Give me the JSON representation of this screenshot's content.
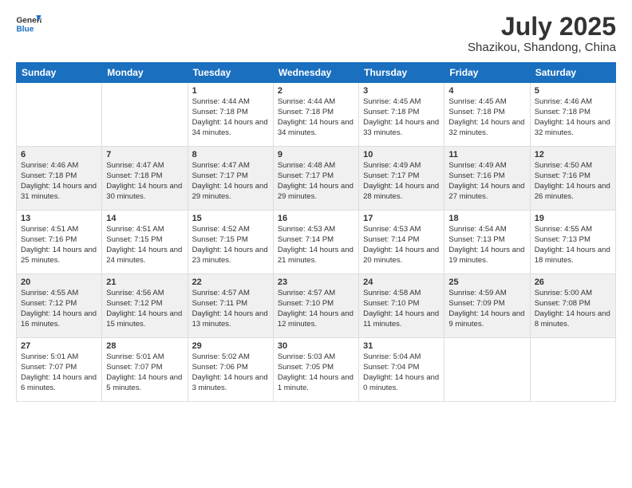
{
  "logo": {
    "line1": "General",
    "line2": "Blue"
  },
  "title": "July 2025",
  "location": "Shazikou, Shandong, China",
  "days_header": [
    "Sunday",
    "Monday",
    "Tuesday",
    "Wednesday",
    "Thursday",
    "Friday",
    "Saturday"
  ],
  "weeks": [
    [
      {
        "day": "",
        "sunrise": "",
        "sunset": "",
        "daylight": ""
      },
      {
        "day": "",
        "sunrise": "",
        "sunset": "",
        "daylight": ""
      },
      {
        "day": "1",
        "sunrise": "Sunrise: 4:44 AM",
        "sunset": "Sunset: 7:18 PM",
        "daylight": "Daylight: 14 hours and 34 minutes."
      },
      {
        "day": "2",
        "sunrise": "Sunrise: 4:44 AM",
        "sunset": "Sunset: 7:18 PM",
        "daylight": "Daylight: 14 hours and 34 minutes."
      },
      {
        "day": "3",
        "sunrise": "Sunrise: 4:45 AM",
        "sunset": "Sunset: 7:18 PM",
        "daylight": "Daylight: 14 hours and 33 minutes."
      },
      {
        "day": "4",
        "sunrise": "Sunrise: 4:45 AM",
        "sunset": "Sunset: 7:18 PM",
        "daylight": "Daylight: 14 hours and 32 minutes."
      },
      {
        "day": "5",
        "sunrise": "Sunrise: 4:46 AM",
        "sunset": "Sunset: 7:18 PM",
        "daylight": "Daylight: 14 hours and 32 minutes."
      }
    ],
    [
      {
        "day": "6",
        "sunrise": "Sunrise: 4:46 AM",
        "sunset": "Sunset: 7:18 PM",
        "daylight": "Daylight: 14 hours and 31 minutes."
      },
      {
        "day": "7",
        "sunrise": "Sunrise: 4:47 AM",
        "sunset": "Sunset: 7:18 PM",
        "daylight": "Daylight: 14 hours and 30 minutes."
      },
      {
        "day": "8",
        "sunrise": "Sunrise: 4:47 AM",
        "sunset": "Sunset: 7:17 PM",
        "daylight": "Daylight: 14 hours and 29 minutes."
      },
      {
        "day": "9",
        "sunrise": "Sunrise: 4:48 AM",
        "sunset": "Sunset: 7:17 PM",
        "daylight": "Daylight: 14 hours and 29 minutes."
      },
      {
        "day": "10",
        "sunrise": "Sunrise: 4:49 AM",
        "sunset": "Sunset: 7:17 PM",
        "daylight": "Daylight: 14 hours and 28 minutes."
      },
      {
        "day": "11",
        "sunrise": "Sunrise: 4:49 AM",
        "sunset": "Sunset: 7:16 PM",
        "daylight": "Daylight: 14 hours and 27 minutes."
      },
      {
        "day": "12",
        "sunrise": "Sunrise: 4:50 AM",
        "sunset": "Sunset: 7:16 PM",
        "daylight": "Daylight: 14 hours and 26 minutes."
      }
    ],
    [
      {
        "day": "13",
        "sunrise": "Sunrise: 4:51 AM",
        "sunset": "Sunset: 7:16 PM",
        "daylight": "Daylight: 14 hours and 25 minutes."
      },
      {
        "day": "14",
        "sunrise": "Sunrise: 4:51 AM",
        "sunset": "Sunset: 7:15 PM",
        "daylight": "Daylight: 14 hours and 24 minutes."
      },
      {
        "day": "15",
        "sunrise": "Sunrise: 4:52 AM",
        "sunset": "Sunset: 7:15 PM",
        "daylight": "Daylight: 14 hours and 23 minutes."
      },
      {
        "day": "16",
        "sunrise": "Sunrise: 4:53 AM",
        "sunset": "Sunset: 7:14 PM",
        "daylight": "Daylight: 14 hours and 21 minutes."
      },
      {
        "day": "17",
        "sunrise": "Sunrise: 4:53 AM",
        "sunset": "Sunset: 7:14 PM",
        "daylight": "Daylight: 14 hours and 20 minutes."
      },
      {
        "day": "18",
        "sunrise": "Sunrise: 4:54 AM",
        "sunset": "Sunset: 7:13 PM",
        "daylight": "Daylight: 14 hours and 19 minutes."
      },
      {
        "day": "19",
        "sunrise": "Sunrise: 4:55 AM",
        "sunset": "Sunset: 7:13 PM",
        "daylight": "Daylight: 14 hours and 18 minutes."
      }
    ],
    [
      {
        "day": "20",
        "sunrise": "Sunrise: 4:55 AM",
        "sunset": "Sunset: 7:12 PM",
        "daylight": "Daylight: 14 hours and 16 minutes."
      },
      {
        "day": "21",
        "sunrise": "Sunrise: 4:56 AM",
        "sunset": "Sunset: 7:12 PM",
        "daylight": "Daylight: 14 hours and 15 minutes."
      },
      {
        "day": "22",
        "sunrise": "Sunrise: 4:57 AM",
        "sunset": "Sunset: 7:11 PM",
        "daylight": "Daylight: 14 hours and 13 minutes."
      },
      {
        "day": "23",
        "sunrise": "Sunrise: 4:57 AM",
        "sunset": "Sunset: 7:10 PM",
        "daylight": "Daylight: 14 hours and 12 minutes."
      },
      {
        "day": "24",
        "sunrise": "Sunrise: 4:58 AM",
        "sunset": "Sunset: 7:10 PM",
        "daylight": "Daylight: 14 hours and 11 minutes."
      },
      {
        "day": "25",
        "sunrise": "Sunrise: 4:59 AM",
        "sunset": "Sunset: 7:09 PM",
        "daylight": "Daylight: 14 hours and 9 minutes."
      },
      {
        "day": "26",
        "sunrise": "Sunrise: 5:00 AM",
        "sunset": "Sunset: 7:08 PM",
        "daylight": "Daylight: 14 hours and 8 minutes."
      }
    ],
    [
      {
        "day": "27",
        "sunrise": "Sunrise: 5:01 AM",
        "sunset": "Sunset: 7:07 PM",
        "daylight": "Daylight: 14 hours and 6 minutes."
      },
      {
        "day": "28",
        "sunrise": "Sunrise: 5:01 AM",
        "sunset": "Sunset: 7:07 PM",
        "daylight": "Daylight: 14 hours and 5 minutes."
      },
      {
        "day": "29",
        "sunrise": "Sunrise: 5:02 AM",
        "sunset": "Sunset: 7:06 PM",
        "daylight": "Daylight: 14 hours and 3 minutes."
      },
      {
        "day": "30",
        "sunrise": "Sunrise: 5:03 AM",
        "sunset": "Sunset: 7:05 PM",
        "daylight": "Daylight: 14 hours and 1 minute."
      },
      {
        "day": "31",
        "sunrise": "Sunrise: 5:04 AM",
        "sunset": "Sunset: 7:04 PM",
        "daylight": "Daylight: 14 hours and 0 minutes."
      },
      {
        "day": "",
        "sunrise": "",
        "sunset": "",
        "daylight": ""
      },
      {
        "day": "",
        "sunrise": "",
        "sunset": "",
        "daylight": ""
      }
    ]
  ]
}
